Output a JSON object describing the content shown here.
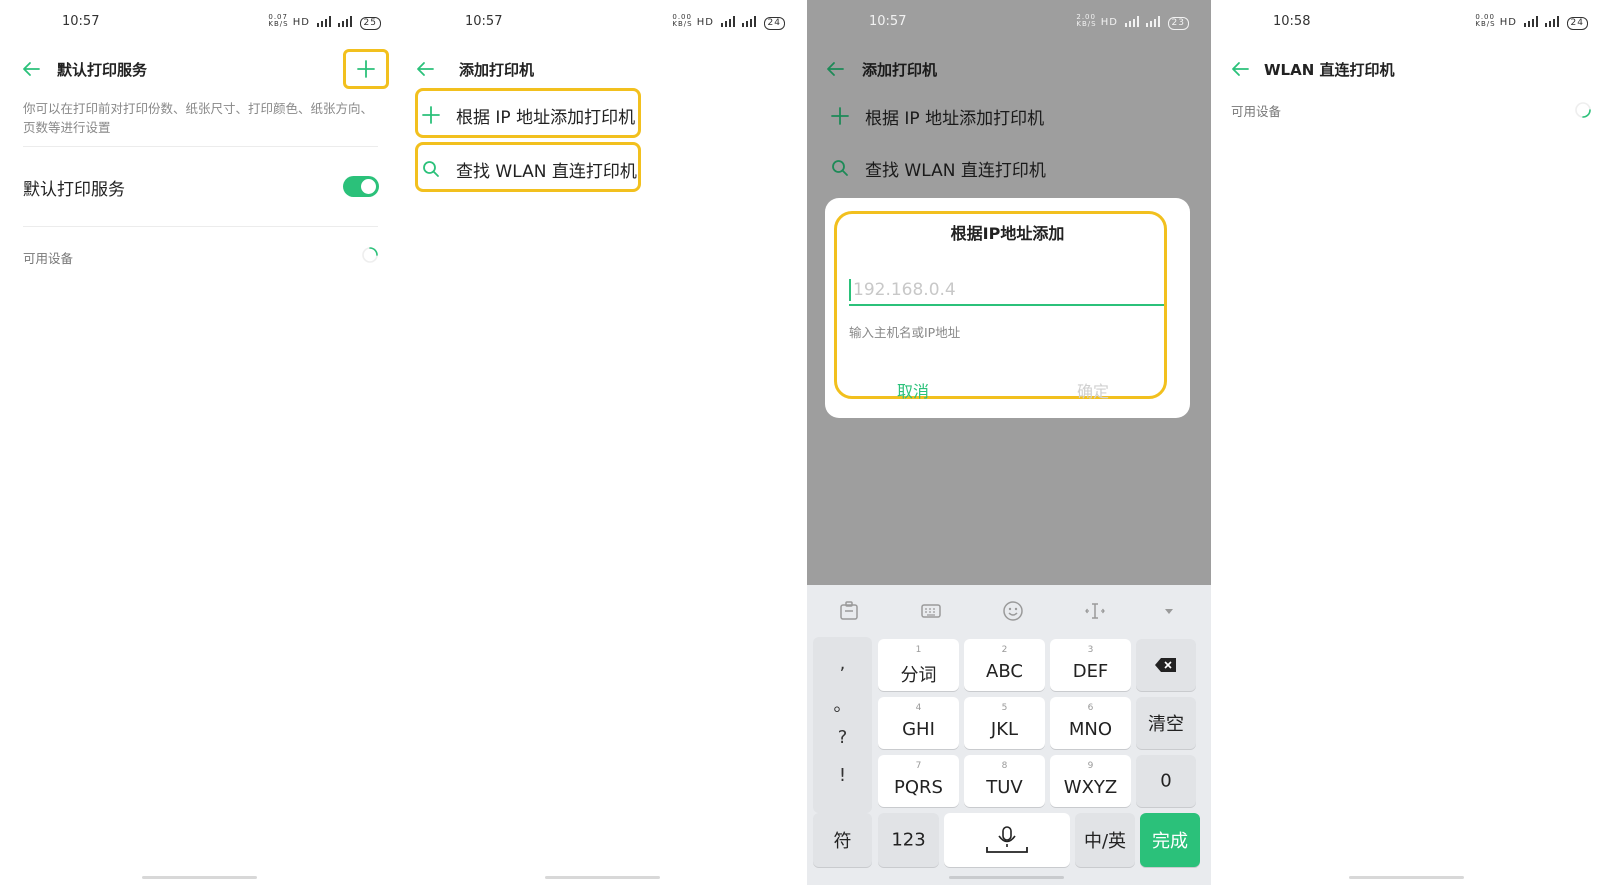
{
  "panel1": {
    "status": {
      "time": "10:57",
      "speed": "0.07\nKB/S",
      "hd": "HD",
      "battery": "25"
    },
    "title": "默认打印服务",
    "description": "你可以在打印前对打印份数、纸张尺寸、打印颜色、纸张方向、页数等进行设置",
    "default_service_label": "默认打印服务",
    "default_service_on": true,
    "available_devices": "可用设备"
  },
  "panel2": {
    "status": {
      "time": "10:57",
      "speed": "0.00\nKB/S",
      "hd": "HD",
      "battery": "24"
    },
    "title": "添加打印机",
    "items": [
      {
        "label": "根据 IP 地址添加打印机",
        "icon": "plus-icon"
      },
      {
        "label": "查找 WLAN 直连打印机",
        "icon": "search-icon"
      }
    ]
  },
  "panel3": {
    "status": {
      "time": "10:57",
      "speed": "2.00\nKB/S",
      "hd": "HD",
      "battery": "23"
    },
    "title": "添加打印机",
    "items": [
      {
        "label": "根据 IP 地址添加打印机",
        "icon": "plus-icon"
      },
      {
        "label": "查找 WLAN 直连打印机",
        "icon": "search-icon"
      }
    ],
    "dialog": {
      "title": "根据IP地址添加",
      "placeholder": "192.168.0.4",
      "hint": "输入主机名或IP地址",
      "cancel": "取消",
      "ok": "确定"
    },
    "keyboard": {
      "punct": [
        ",",
        "。",
        "?",
        "!"
      ],
      "rows": [
        [
          {
            "num": "1",
            "label": "分词"
          },
          {
            "num": "2",
            "label": "ABC"
          },
          {
            "num": "3",
            "label": "DEF"
          }
        ],
        [
          {
            "num": "4",
            "label": "GHI"
          },
          {
            "num": "5",
            "label": "JKL"
          },
          {
            "num": "6",
            "label": "MNO"
          }
        ],
        [
          {
            "num": "7",
            "label": "PQRS"
          },
          {
            "num": "8",
            "label": "TUV"
          },
          {
            "num": "9",
            "label": "WXYZ"
          }
        ]
      ],
      "clear": "清空",
      "zero": "0",
      "symbols": "符",
      "numbers": "123",
      "lang": "中/英",
      "done": "完成"
    }
  },
  "panel4": {
    "status": {
      "time": "10:58",
      "speed": "0.00\nKB/S",
      "hd": "HD",
      "battery": "24"
    },
    "title": "WLAN 直连打印机",
    "available_devices": "可用设备"
  },
  "colors": {
    "accent": "#2bc17a",
    "highlight": "#f2c01e",
    "dim_overlay": "#9e9e9e"
  }
}
